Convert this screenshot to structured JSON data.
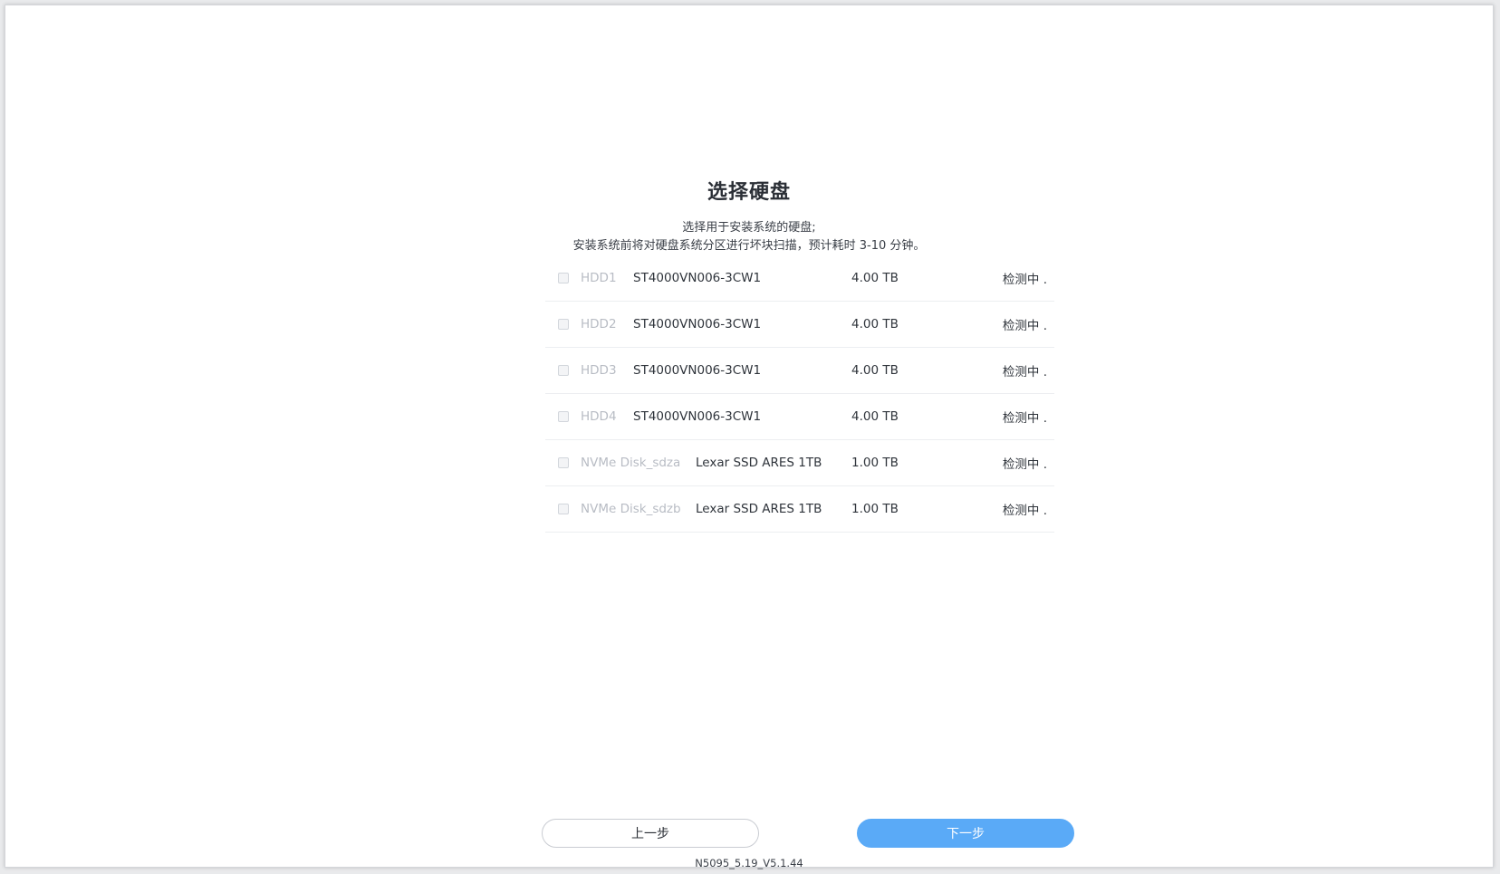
{
  "page": {
    "title": "选择硬盘",
    "description_line1": "选择用于安装系统的硬盘;",
    "description_line2": "安装系统前将对硬盘系统分区进行坏块扫描，预计耗时 3-10 分钟。"
  },
  "disks": [
    {
      "name": "HDD1",
      "model": "ST4000VN006-3CW1",
      "size": "4.00 TB",
      "status": "检测中 ."
    },
    {
      "name": "HDD2",
      "model": "ST4000VN006-3CW1",
      "size": "4.00 TB",
      "status": "检测中 ."
    },
    {
      "name": "HDD3",
      "model": "ST4000VN006-3CW1",
      "size": "4.00 TB",
      "status": "检测中 ."
    },
    {
      "name": "HDD4",
      "model": "ST4000VN006-3CW1",
      "size": "4.00 TB",
      "status": "检测中 ."
    },
    {
      "name": "NVMe Disk_sdza",
      "model": "Lexar SSD ARES 1TB",
      "size": "1.00 TB",
      "status": "检测中 ."
    },
    {
      "name": "NVMe Disk_sdzb",
      "model": "Lexar SSD ARES 1TB",
      "size": "1.00 TB",
      "status": "检测中 ."
    }
  ],
  "buttons": {
    "prev_label": "上一步",
    "next_label": "下一步"
  },
  "footer": {
    "version": "N5095_5.19_V5.1.44"
  },
  "colors": {
    "accent": "#5aaaf7",
    "disabled_text": "#b8bcc4"
  }
}
